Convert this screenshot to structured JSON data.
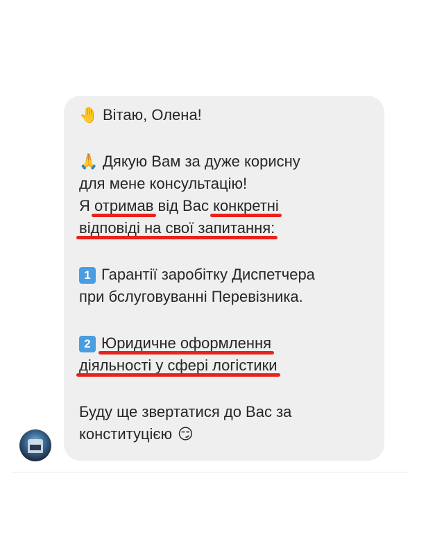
{
  "message": {
    "greeting_emoji": "🤚",
    "greeting": "Вітаю, Олена!",
    "thanks_emoji": "🙏",
    "thanks_line1": "Дякую Вам за дуже корисну",
    "thanks_line2": "для мене консультацію!",
    "got_prefix": "Я ",
    "got_word": "отримав",
    "got_middle": " від Вас ",
    "got_concrete": "конкретні",
    "answers": "відповіді на свої запитання:",
    "item1_key": "1",
    "item1_line1": "Гарантії заробітку Диспетчера",
    "item1_line2": "при бслуговуванні Перевізника.",
    "item2_key": "2",
    "item2_line1": "Юридичне оформлення",
    "item2_line2": "діяльності у сфері логістики",
    "closing_line1": "Буду ще звертатися до Вас за",
    "closing_line2": "конституцією",
    "closing_emoji": "😏"
  },
  "colors": {
    "bubble": "#efefef",
    "underline": "#e8231b",
    "keycap": "#4a9de0",
    "text": "#262626"
  },
  "icons": {
    "avatar": "truck-avatar"
  }
}
